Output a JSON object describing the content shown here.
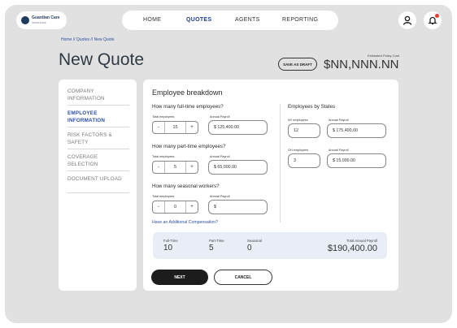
{
  "brand": {
    "name": "Guardian Care",
    "tagline": "INSURANCE"
  },
  "nav": {
    "home": "HOME",
    "quotes": "QUOTES",
    "agents": "AGENTS",
    "reporting": "REPORTING"
  },
  "icons": {
    "profile": "user-icon",
    "notifications": "bell-icon",
    "logo": "shield-logo-icon"
  },
  "breadcrumb": "Home // Quotes // New Quote",
  "page_title": "New Quote",
  "save_draft_label": "SAVE AS DRAFT",
  "estimated_cost": {
    "label": "Estimated Policy Cost",
    "value": "$NN,NNN.NN"
  },
  "sidebar": {
    "items": [
      {
        "label": "COMPANY INFORMATION",
        "active": false
      },
      {
        "label": "EMPLOYEE INFORMATION",
        "active": true
      },
      {
        "label": "RISK FACTORS & SAFETY",
        "active": false
      },
      {
        "label": "COVERAGE SELECTION",
        "active": false
      },
      {
        "label": "DOCUMENT UPLOAD",
        "active": false
      }
    ]
  },
  "form": {
    "section_title": "Employee breakdown",
    "fulltime": {
      "question": "How many full-time employees?",
      "total_label": "Total employees",
      "total_value": "15",
      "payroll_label": "Annual Payroll",
      "payroll_value": "$ 125,400.00"
    },
    "parttime": {
      "question": "How many part-time employees?",
      "total_label": "Total employees",
      "total_value": "5",
      "payroll_label": "Annual Payroll",
      "payroll_value": "$ 65,000.00"
    },
    "seasonal": {
      "question": "How many seasonal workers?",
      "total_label": "Total employees",
      "total_value": "0",
      "payroll_label": "Annual Payroll",
      "payroll_placeholder": "$"
    },
    "minus": "-",
    "plus": "+",
    "additional_link": "Have an Additional Compensation?",
    "states": {
      "title": "Employees by States",
      "ny": {
        "employees_label": "NY employees",
        "employees_value": "12",
        "payroll_label": "Annual Payroll",
        "payroll_value": "$ 175,400.00"
      },
      "oh": {
        "employees_label": "OH employees",
        "employees_value": "3",
        "payroll_label": "Annual Payroll",
        "payroll_value": "$ 15,000.00"
      }
    }
  },
  "summary": {
    "fulltime_label": "Full-Time",
    "fulltime_value": "10",
    "parttime_label": "Part-Time",
    "parttime_value": "5",
    "seasonal_label": "Seasonal",
    "seasonal_value": "0",
    "total_label": "Total Annual Payroll",
    "total_value": "$190,400.00"
  },
  "buttons": {
    "next": "NEXT",
    "cancel": "CANCEL"
  },
  "colors": {
    "accent": "#2b50a6",
    "badge": "#e53935",
    "primary_button": "#1c1c1c"
  }
}
